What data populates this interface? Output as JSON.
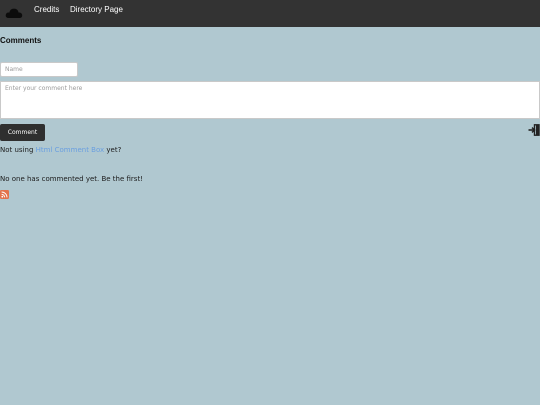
{
  "nav": {
    "logo_icon": "cloud-icon",
    "links": [
      "Credits",
      "Directory Page"
    ]
  },
  "comments": {
    "heading": "Comments",
    "name_placeholder": "Name",
    "comment_placeholder": "Enter your comment here",
    "submit_label": "Comment",
    "login_icon": "sign-in-icon",
    "promo_prefix": "Not using",
    "promo_link": "Html Comment Box",
    "promo_suffix": "yet?",
    "empty_message": "No one has commented yet. Be the first!",
    "rss_icon": "rss-icon"
  },
  "colors": {
    "background": "#b0c8d0",
    "navbar": "#333333",
    "link": "#6a9fe0",
    "button": "#2f2f2f",
    "rss": "#e3734c"
  }
}
